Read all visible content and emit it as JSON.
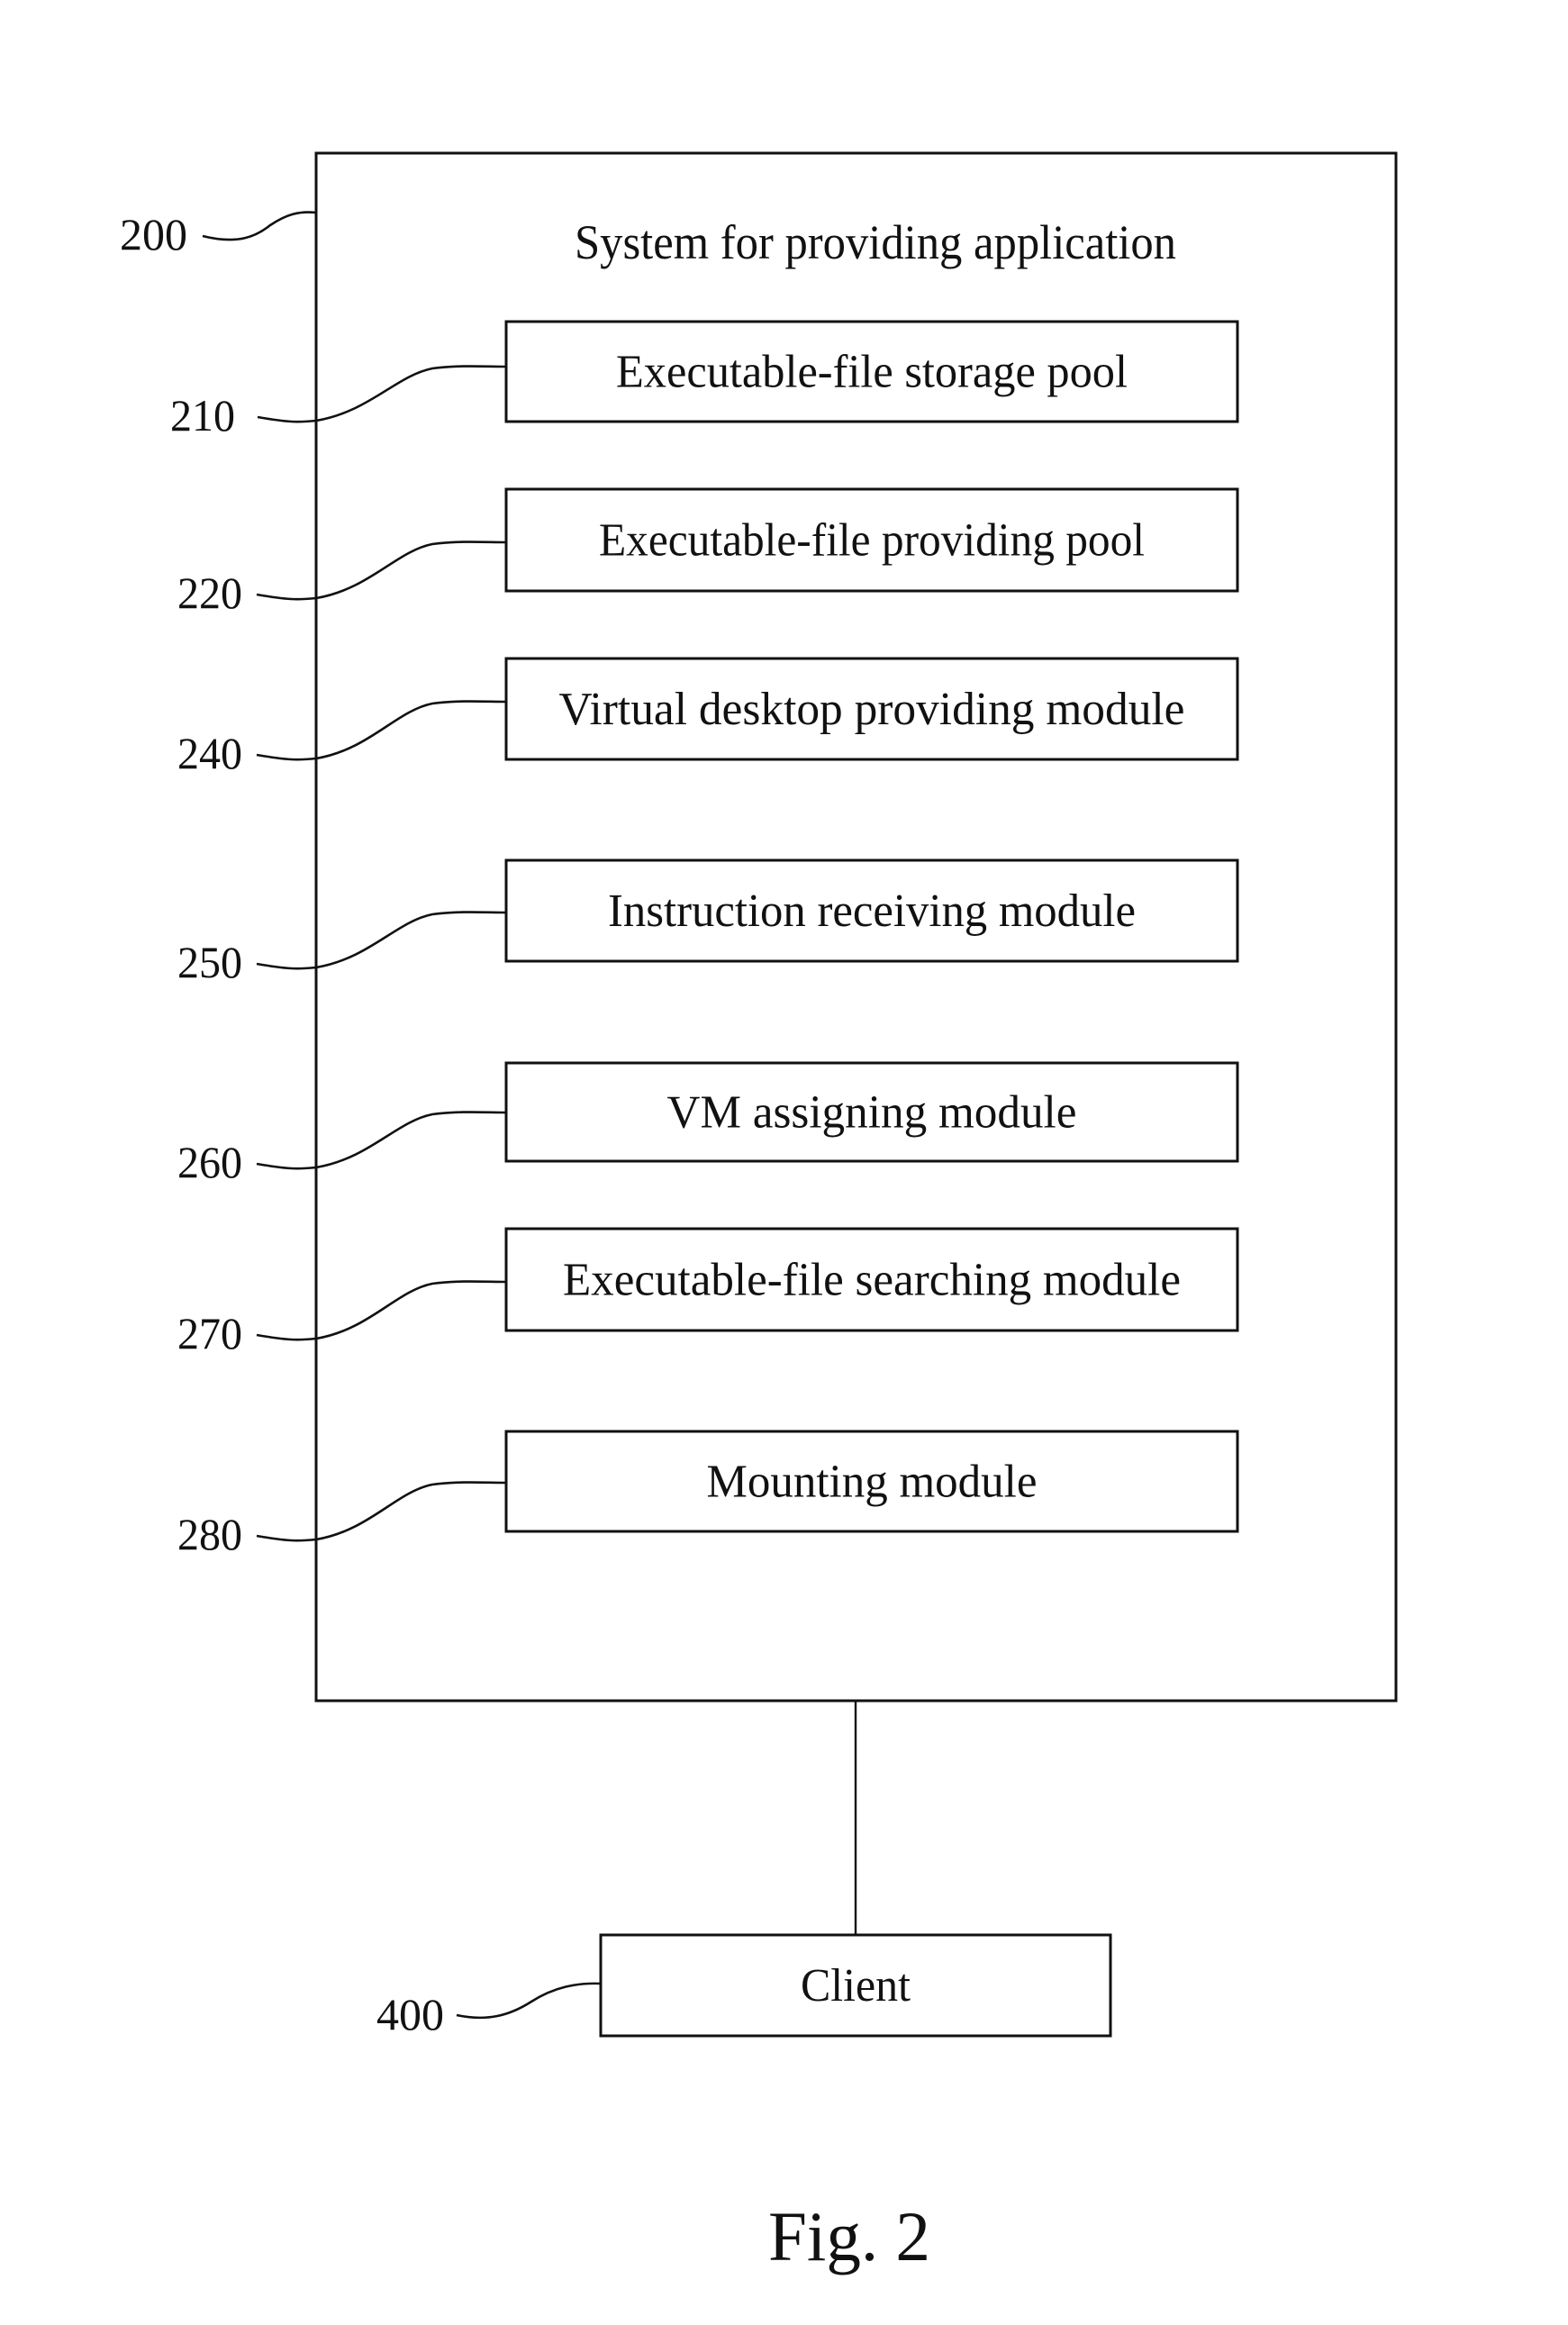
{
  "system": {
    "ref": "200",
    "title": "System for providing application"
  },
  "modules": [
    {
      "ref": "210",
      "label": "Executable-file storage pool"
    },
    {
      "ref": "220",
      "label": "Executable-file providing pool"
    },
    {
      "ref": "240",
      "label": "Virtual desktop providing module"
    },
    {
      "ref": "250",
      "label": "Instruction receiving module"
    },
    {
      "ref": "260",
      "label": "VM assigning module"
    },
    {
      "ref": "270",
      "label": "Executable-file searching module"
    },
    {
      "ref": "280",
      "label": "Mounting module"
    }
  ],
  "client": {
    "ref": "400",
    "label": "Client"
  },
  "caption": "Fig. 2"
}
